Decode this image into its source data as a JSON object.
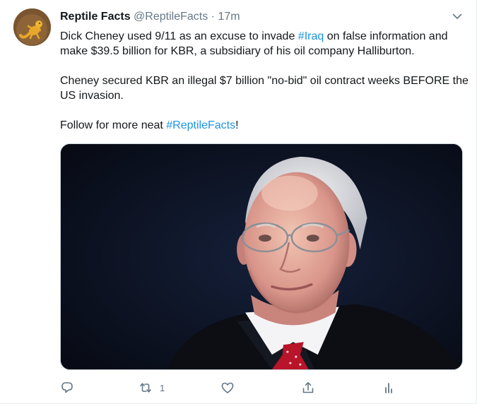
{
  "tweet": {
    "display_name": "Reptile Facts",
    "handle": "@ReptileFacts",
    "separator": "·",
    "time": "17m",
    "paragraph1": {
      "before": "Dick Cheney used 9/11 as an excuse to invade ",
      "hashtag": "#Iraq",
      "after": " on false information and make $39.5 billion for KBR, a subsidiary of his oil company Halliburton."
    },
    "paragraph2": "Cheney secured KBR an illegal $7 billion \"no-bid\" oil contract weeks BEFORE the US invasion.",
    "paragraph3": {
      "before": "Follow for more neat ",
      "hashtag": "#ReptileFacts",
      "after": "!"
    }
  },
  "actions": {
    "reply_icon": "reply-icon",
    "retweet_icon": "retweet-icon",
    "retweet_count": "1",
    "like_icon": "heart-icon",
    "share_icon": "share-icon",
    "analytics_icon": "analytics-icon"
  },
  "colors": {
    "accent": "#1b95e0",
    "secondary_text": "#657786",
    "primary_text": "#14171a"
  }
}
